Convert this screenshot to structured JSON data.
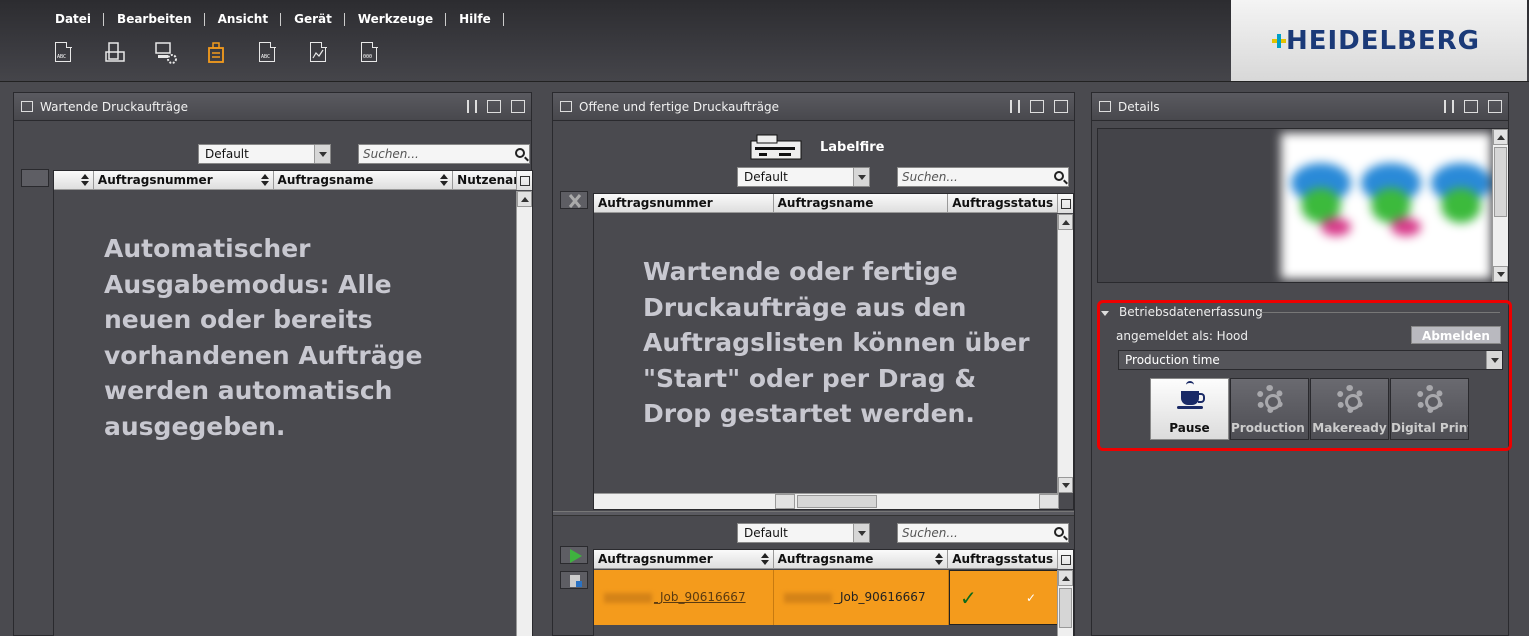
{
  "menu": [
    "Datei",
    "Bearbeiten",
    "Ansicht",
    "Gerät",
    "Werkzeuge",
    "Hilfe"
  ],
  "toolbar_icons": [
    "abc-document-icon",
    "printer-icon",
    "computer-gear-icon",
    "job-ticket-icon",
    "abc-arrow-document-icon",
    "chart-document-icon",
    "barcode-document-icon"
  ],
  "logo": "HEIDELBERG",
  "colors": {
    "accent_orange": "#f49b1c",
    "highlight_red": "#e00000",
    "logo_blue": "#1b3a78"
  },
  "left_panel": {
    "title": "Wartende Druckaufträge",
    "filter": "Default",
    "search_placeholder": "Suchen...",
    "columns": [
      "Auftragsnummer",
      "Auftragsname",
      "Nutzenan..."
    ],
    "overlay_lines": [
      "Automatischer",
      "Ausgabemodus: Alle",
      "neuen oder bereits",
      "vorhandenen Aufträge",
      "werden automatisch",
      "ausgegeben."
    ]
  },
  "middle_panel": {
    "title": "Offene und fertige Druckaufträge",
    "printer_name": "Labelfire",
    "filter": "Default",
    "search_placeholder": "Suchen...",
    "columns": [
      "Auftragsnummer",
      "Auftragsname",
      "Auftragsstatus"
    ],
    "overlay_lines": [
      "Wartende oder fertige",
      "Druckaufträge aus den",
      "Auftragslisten können über",
      "\"Start\" oder per Drag &",
      "Drop gestartet werden."
    ],
    "lower_filter": "Default",
    "lower_search_placeholder": "Suchen...",
    "lower_columns": [
      "Auftragsnummer",
      "Auftragsname",
      "Auftragsstatus"
    ],
    "lower_row": {
      "number": "_Job_90616667",
      "name": "_Job_90616667",
      "status_mark": "✓",
      "status_small": "✓"
    }
  },
  "details_panel": {
    "title": "Details",
    "section_title": "Betriebsdatenerfassung",
    "logged_in_as": "angemeldet als: Hood",
    "logout_label": "Abmelden",
    "time_select": "Production time",
    "buttons": [
      {
        "label": "Pause",
        "icon": "coffee-cup-icon",
        "active": true
      },
      {
        "label": "Production ...",
        "icon": "gear-icon",
        "active": false
      },
      {
        "label": "Makeready",
        "icon": "gear-icon",
        "active": false
      },
      {
        "label": "Digital Print...",
        "icon": "gear-icon",
        "active": false
      }
    ]
  }
}
